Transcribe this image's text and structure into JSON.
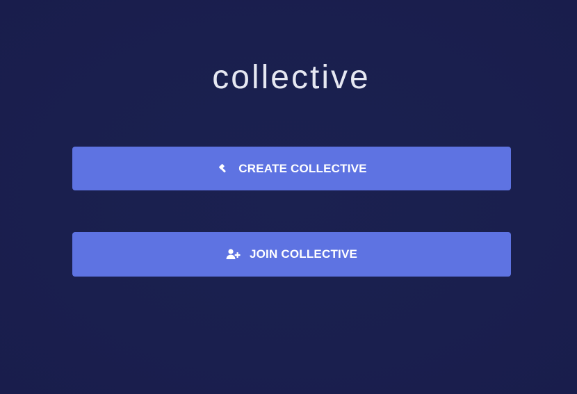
{
  "app": {
    "title": "collective"
  },
  "actions": {
    "create": {
      "label": "CREATE COLLECTIVE",
      "icon": "gavel-icon"
    },
    "join": {
      "label": "JOIN COLLECTIVE",
      "icon": "user-plus-icon"
    }
  },
  "colors": {
    "background": "#1a1f4e",
    "button": "#5e73e2",
    "title": "#e6e8f2",
    "button_text": "#ffffff"
  }
}
